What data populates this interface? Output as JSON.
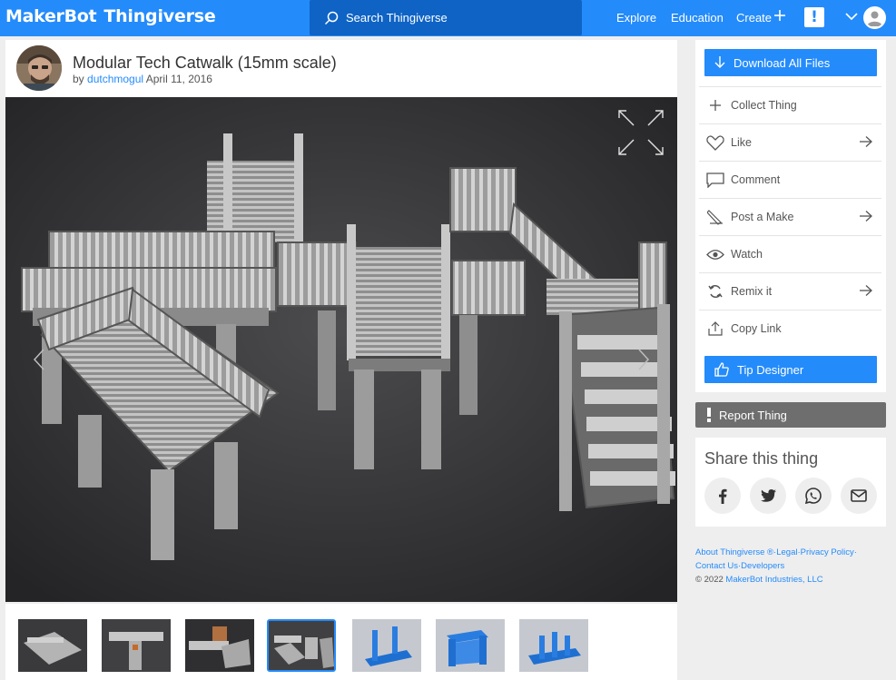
{
  "brand": {
    "part1": "MakerBot",
    "part2": "Thingiverse"
  },
  "search": {
    "placeholder": "Search Thingiverse"
  },
  "nav": {
    "explore": "Explore",
    "education": "Education",
    "create": "Create",
    "alert": "!"
  },
  "thing": {
    "title": "Modular Tech Catwalk (15mm scale)",
    "by": "by",
    "author": "dutchmogul",
    "date": "April 11, 2016"
  },
  "thumbnails": [
    {
      "kind": "photo"
    },
    {
      "kind": "photo"
    },
    {
      "kind": "photo"
    },
    {
      "kind": "photo",
      "selected": true
    },
    {
      "kind": "render"
    },
    {
      "kind": "render"
    },
    {
      "kind": "render"
    }
  ],
  "sidebar": {
    "download": "Download All Files",
    "actions": [
      {
        "label": "Collect Thing",
        "icon": "plus-icon",
        "arrow": false
      },
      {
        "label": "Like",
        "icon": "heart-icon",
        "arrow": true
      },
      {
        "label": "Comment",
        "icon": "comment-icon",
        "arrow": false
      },
      {
        "label": "Post a Make",
        "icon": "pencil-icon",
        "arrow": true
      },
      {
        "label": "Watch",
        "icon": "eye-icon",
        "arrow": false
      },
      {
        "label": "Remix it",
        "icon": "remix-icon",
        "arrow": true
      },
      {
        "label": "Copy Link",
        "icon": "share-icon",
        "arrow": false
      }
    ],
    "tip": "Tip Designer",
    "report": "Report Thing"
  },
  "share": {
    "title": "Share this thing",
    "networks": [
      "facebook-icon",
      "twitter-icon",
      "whatsapp-icon",
      "email-icon"
    ]
  },
  "footer": {
    "about": "About Thingiverse",
    "registered": "®",
    "legal": "Legal",
    "privacy": "Privacy Policy",
    "contact": "Contact Us",
    "developers": "Developers",
    "copyright": "©  2022",
    "company": "MakerBot Industries, LLC"
  },
  "colors": {
    "accent": "#248bfb",
    "search_bg": "#0e63c5",
    "report_bg": "#6e6e6e"
  }
}
